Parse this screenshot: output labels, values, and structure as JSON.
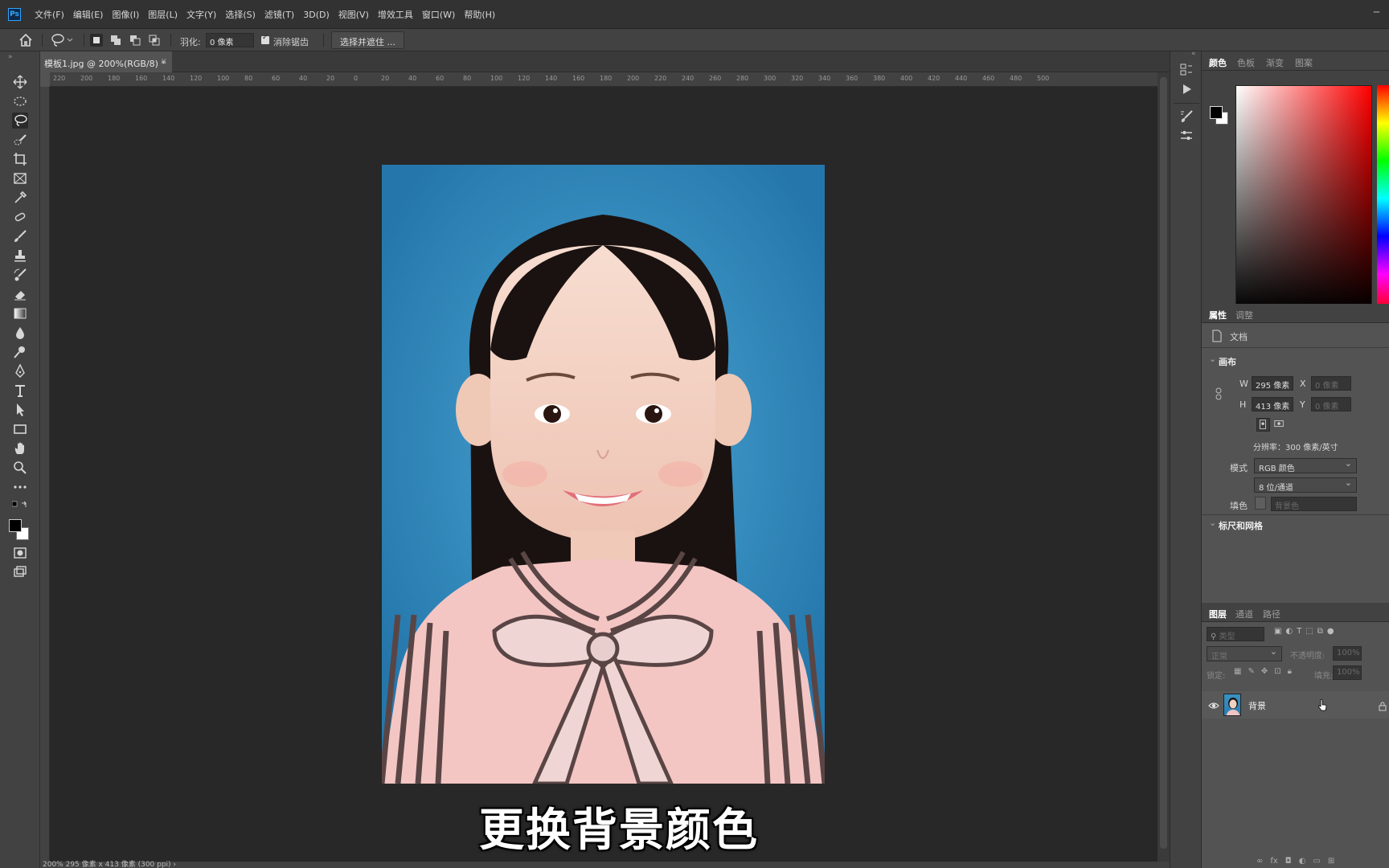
{
  "app": {
    "logo": "Ps"
  },
  "menu": [
    "文件(F)",
    "编辑(E)",
    "图像(I)",
    "图层(L)",
    "文字(Y)",
    "选择(S)",
    "滤镜(T)",
    "3D(D)",
    "视图(V)",
    "增效工具",
    "窗口(W)",
    "帮助(H)"
  ],
  "options": {
    "feather_label": "羽化:",
    "feather_value": "0 像素",
    "antialias_label": "消除锯齿",
    "antialias_checked": true,
    "select_mask_button": "选择并遮住 ..."
  },
  "document": {
    "tab_title": "模板1.jpg @ 200%(RGB/8) *",
    "status": "200%     295 像素 x 413 像素 (300 ppi)    ›",
    "subtitle": "更换背景颜色"
  },
  "ruler_top_labels": [
    "220",
    "200",
    "180",
    "160",
    "140",
    "120",
    "100",
    "80",
    "60",
    "40",
    "20",
    "0",
    "20",
    "40",
    "60",
    "80",
    "100",
    "120",
    "140",
    "160",
    "180",
    "200",
    "220",
    "240",
    "260",
    "280",
    "300",
    "320",
    "340",
    "360",
    "380",
    "400",
    "420",
    "440",
    "460",
    "480",
    "500"
  ],
  "color_panel": {
    "tabs": [
      "颜色",
      "色板",
      "渐变",
      "图案"
    ],
    "foreground": "#000000",
    "background": "#ffffff"
  },
  "properties_panel": {
    "tabs": [
      "属性",
      "调整"
    ],
    "doc_label": "文档",
    "canvas_section": "画布",
    "w_label": "W",
    "w_value": "295 像素",
    "h_label": "H",
    "h_value": "413 像素",
    "x_label": "X",
    "x_value": "0 像素",
    "y_label": "Y",
    "y_value": "0 像素",
    "resolution": "分辨率：300 像素/英寸",
    "mode_label": "模式",
    "mode_value": "RGB 颜色",
    "depth_value": "8 位/通道",
    "fill_label": "填色",
    "fill_value": "背景色",
    "rulers_section": "标尺和网格"
  },
  "layers_panel": {
    "tabs": [
      "图层",
      "通道",
      "路径"
    ],
    "filter_placeholder": "类型",
    "blend_mode": "正常",
    "opacity_label": "不透明度:",
    "opacity_value": "100%",
    "lock_label": "锁定:",
    "fill_label": "填充:",
    "fill_value": "100%",
    "layer_name": "背景"
  }
}
